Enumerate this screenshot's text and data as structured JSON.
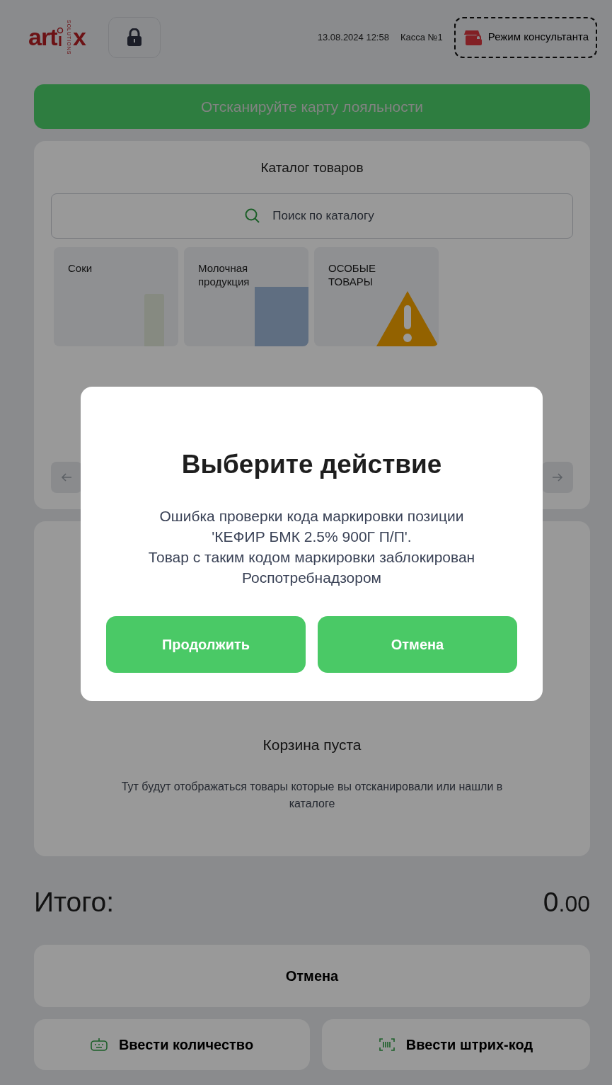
{
  "header": {
    "logo": {
      "left": "art",
      "right": "x",
      "tagline": "SOLUTIONS"
    },
    "datetime": "13.08.2024 12:58",
    "register": "Касса №1",
    "consultant_button": "Режим консультанта"
  },
  "loyalty_banner": "Отсканируйте карту лояльности",
  "catalog": {
    "title": "Каталог товаров",
    "search": {
      "placeholder": "Поиск по каталогу"
    },
    "categories": [
      {
        "label": "Соки",
        "kind": "juice"
      },
      {
        "label": "Молочная продукция",
        "kind": "milk"
      },
      {
        "label": "ОСОБЫЕ ТОВАРЫ",
        "kind": "warning"
      }
    ]
  },
  "cart": {
    "title": "Корзина пуста",
    "description": "Тут будут отображаться товары которые вы отсканировали или нашли в каталоге"
  },
  "total": {
    "label": "Итого:",
    "integer": "0",
    "fraction": ".00"
  },
  "actions": [
    {
      "label": "Отмена",
      "kind": "wide"
    },
    {
      "label": "Ввести количество",
      "kind": "keyboard"
    },
    {
      "label": "Ввести штрих-код",
      "kind": "barcode"
    }
  ],
  "dialog": {
    "title": "Выберите действие",
    "message": "Ошибка проверки кода маркировки позиции\n'КЕФИР БМК 2.5% 900Г П/П'.\nТовар с таким кодом маркировки заблокирован\nРоспотребнадзором",
    "buttons": [
      "Продолжить",
      "Отмена"
    ]
  }
}
